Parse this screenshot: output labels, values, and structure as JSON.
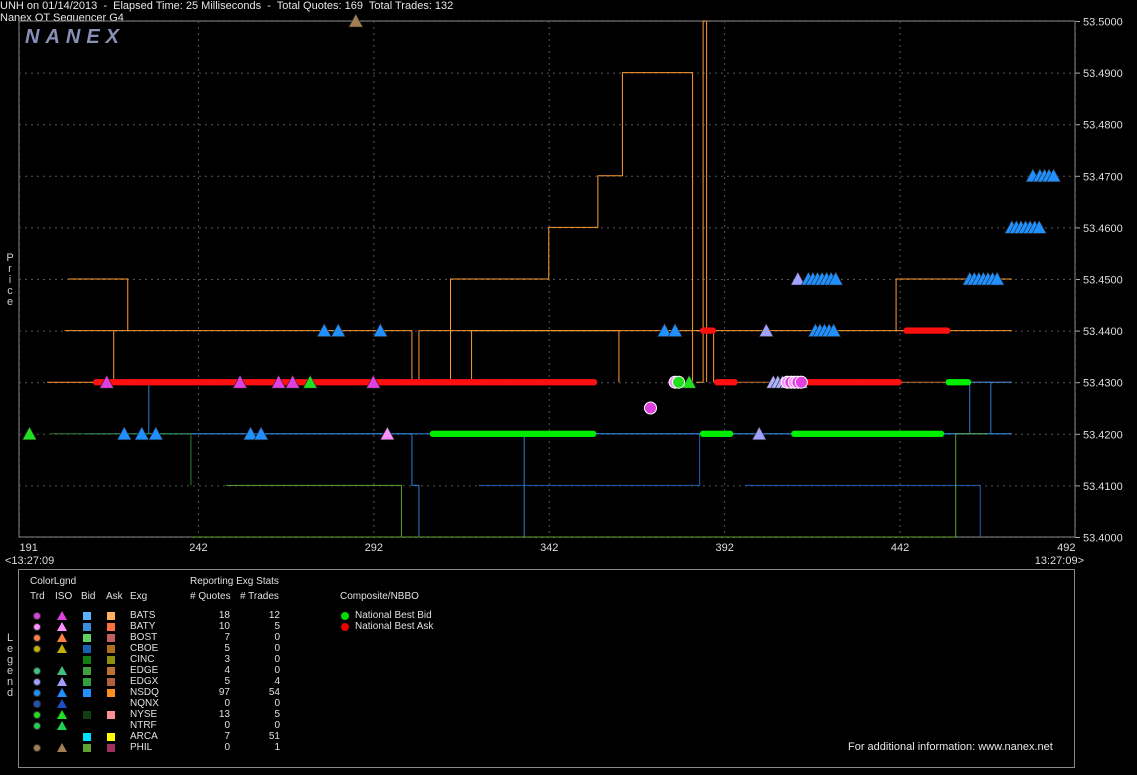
{
  "header": {
    "left": "UNH on 01/14/2013  -  Elapsed Time: 25 Milliseconds  -  Total Quotes: 169  Total Trades: 132",
    "right": "Nanex QT Sequencer G4"
  },
  "watermark": "NANEX",
  "side_labels": {
    "price": [
      "P",
      "r",
      "i",
      "c",
      "e"
    ],
    "legend": [
      "L",
      "e",
      "g",
      "e",
      "n",
      "d"
    ]
  },
  "x_axis": {
    "ticks": [
      "191",
      "242",
      "292",
      "342",
      "392",
      "442",
      "492"
    ],
    "start_time": "<13:27:09",
    "end_time": "13:27:09>"
  },
  "legend": {
    "title": "ColorLgnd",
    "col_headers": [
      "Trd",
      "ISO",
      "Bid",
      "Ask",
      "Exg"
    ],
    "stats_title": "Reporting Exg Stats",
    "stats_headers": [
      "# Quotes",
      "# Trades"
    ],
    "composite_title": "Composite/NBBO",
    "composite_items": [
      {
        "label": "National Best Bid",
        "color": "#00dd00"
      },
      {
        "label": "National Best Ask",
        "color": "#ee0000"
      }
    ],
    "rows": [
      {
        "exg": "BATS",
        "quotes": "18",
        "trades": "12",
        "trd": "#e040e0",
        "iso": "#e040e0",
        "bid": "#5bb0ff",
        "ask": "#ffb060"
      },
      {
        "exg": "BATY",
        "quotes": "10",
        "trades": "5",
        "trd": "#ff90ff",
        "iso": "#ff90ff",
        "bid": "#3a8fd8",
        "ask": "#ff7040"
      },
      {
        "exg": "BOST",
        "quotes": "7",
        "trades": "0",
        "trd": "#ff8040",
        "iso": "#ff8040",
        "bid": "#60d060",
        "ask": "#c06060"
      },
      {
        "exg": "CBOE",
        "quotes": "5",
        "trades": "0",
        "trd": "#c0b000",
        "iso": "#c0b000",
        "bid": "#1860b0",
        "ask": "#b07020"
      },
      {
        "exg": "CINC",
        "quotes": "3",
        "trades": "0",
        "trd": "",
        "iso": "",
        "bid": "#108010",
        "ask": "#909010"
      },
      {
        "exg": "EDGE",
        "quotes": "4",
        "trades": "0",
        "trd": "#40c080",
        "iso": "#40c080",
        "bid": "#40a040",
        "ask": "#c07030"
      },
      {
        "exg": "EDGX",
        "quotes": "5",
        "trades": "4",
        "trd": "#a0a0ff",
        "iso": "#a0a0ff",
        "bid": "#30a040",
        "ask": "#b06040"
      },
      {
        "exg": "NSDQ",
        "quotes": "97",
        "trades": "54",
        "trd": "#2090ff",
        "iso": "#2090ff",
        "bid": "#2090ff",
        "ask": "#ff9020"
      },
      {
        "exg": "NQNX",
        "quotes": "0",
        "trades": "0",
        "trd": "#2050c0",
        "iso": "#2050c0",
        "bid": "",
        "ask": ""
      },
      {
        "exg": "NYSE",
        "quotes": "13",
        "trades": "5",
        "trd": "#20e020",
        "iso": "#20e020",
        "bid": "#104010",
        "ask": "#ff9090"
      },
      {
        "exg": "NTRF",
        "quotes": "0",
        "trades": "0",
        "trd": "#20d050",
        "iso": "#20d050",
        "bid": "",
        "ask": ""
      },
      {
        "exg": "ARCA",
        "quotes": "7",
        "trades": "51",
        "trd": "",
        "iso": "",
        "bid": "#00e0ff",
        "ask": "#ffff00"
      },
      {
        "exg": "PHIL",
        "quotes": "0",
        "trades": "1",
        "trd": "#a08050",
        "iso": "#a08050",
        "bid": "#60a030",
        "ask": "#a03060"
      }
    ]
  },
  "footer": "For additional information: www.nanex.net",
  "chart_data": {
    "type": "line",
    "title": "UNH on 01/14/2013",
    "xlabel": "",
    "ylabel": "Price",
    "xlim": [
      191,
      492
    ],
    "ylim": [
      53.4,
      53.5
    ],
    "y_ticks": [
      "53.5000",
      "53.4900",
      "53.4800",
      "53.4700",
      "53.4600",
      "53.4500",
      "53.4400",
      "53.4300",
      "53.4200",
      "53.4100",
      "53.4000"
    ],
    "grid": true,
    "colors": {
      "bid_line": "#2e7fd0",
      "ask_line": "#ff9a30",
      "bbo_bid": "#00ee00",
      "bbo_ask": "#ff1010"
    },
    "series": [
      {
        "name": "National Best Bid",
        "color": "#00dd00",
        "points": [
          [
            263,
            53.43
          ],
          [
            309,
            53.42
          ],
          [
            353,
            53.42
          ],
          [
            376,
            53.42
          ],
          [
            385,
            53.42
          ],
          [
            395,
            53.42
          ],
          [
            410,
            53.42
          ],
          [
            448,
            53.42
          ],
          [
            456,
            53.43
          ],
          [
            467,
            53.43
          ]
        ]
      },
      {
        "name": "National Best Ask",
        "color": "#ff1010",
        "points": [
          [
            260,
            53.43
          ],
          [
            355,
            53.43
          ],
          [
            367,
            53.44
          ],
          [
            386,
            53.43
          ],
          [
            410,
            53.43
          ],
          [
            440,
            53.44
          ],
          [
            444,
            53.44
          ]
        ]
      }
    ],
    "trades": [
      {
        "x": 194,
        "y": 53.42,
        "color": "#20e020",
        "shape": "tri"
      },
      {
        "x": 216,
        "y": 53.43,
        "color": "#e040e0",
        "shape": "tri"
      },
      {
        "x": 221,
        "y": 53.42,
        "color": "#2090ff",
        "shape": "tri"
      },
      {
        "x": 226,
        "y": 53.42,
        "color": "#2090ff",
        "shape": "tri"
      },
      {
        "x": 230,
        "y": 53.42,
        "color": "#2090ff",
        "shape": "tri"
      },
      {
        "x": 254,
        "y": 53.43,
        "color": "#e040e0",
        "shape": "tri"
      },
      {
        "x": 257,
        "y": 53.42,
        "color": "#2090ff",
        "shape": "tri"
      },
      {
        "x": 260,
        "y": 53.42,
        "color": "#2090ff",
        "shape": "tri"
      },
      {
        "x": 265,
        "y": 53.43,
        "color": "#e040e0",
        "shape": "tri"
      },
      {
        "x": 269,
        "y": 53.43,
        "color": "#e040e0",
        "shape": "tri"
      },
      {
        "x": 274,
        "y": 53.43,
        "color": "#20e020",
        "shape": "tri"
      },
      {
        "x": 278,
        "y": 53.44,
        "color": "#2090ff",
        "shape": "tri"
      },
      {
        "x": 282,
        "y": 53.44,
        "color": "#2090ff",
        "shape": "tri"
      },
      {
        "x": 287,
        "y": 53.5,
        "color": "#a08050",
        "shape": "tri"
      },
      {
        "x": 292,
        "y": 53.43,
        "color": "#e040e0",
        "shape": "tri"
      },
      {
        "x": 294,
        "y": 53.44,
        "color": "#2090ff",
        "shape": "tri"
      },
      {
        "x": 296,
        "y": 53.42,
        "color": "#ff90ff",
        "shape": "tri"
      },
      {
        "x": 371,
        "y": 53.425,
        "color": "#e040e0",
        "shape": "dot"
      },
      {
        "x": 375,
        "y": 53.44,
        "color": "#2090ff",
        "shape": "tri"
      },
      {
        "x": 378,
        "y": 53.44,
        "color": "#2090ff",
        "shape": "tri"
      },
      {
        "x": 382,
        "y": 53.43,
        "color": "#20e020",
        "shape": "tri"
      },
      {
        "x": 402,
        "y": 53.42,
        "color": "#a0a0ff",
        "shape": "tri"
      },
      {
        "x": 404,
        "y": 53.44,
        "color": "#a0a0ff",
        "shape": "tri"
      },
      {
        "x": 413,
        "y": 53.45,
        "color": "#a0a0ff",
        "shape": "tri"
      },
      {
        "x": 480,
        "y": 53.47,
        "color": "#2090ff",
        "shape": "tri"
      }
    ]
  }
}
